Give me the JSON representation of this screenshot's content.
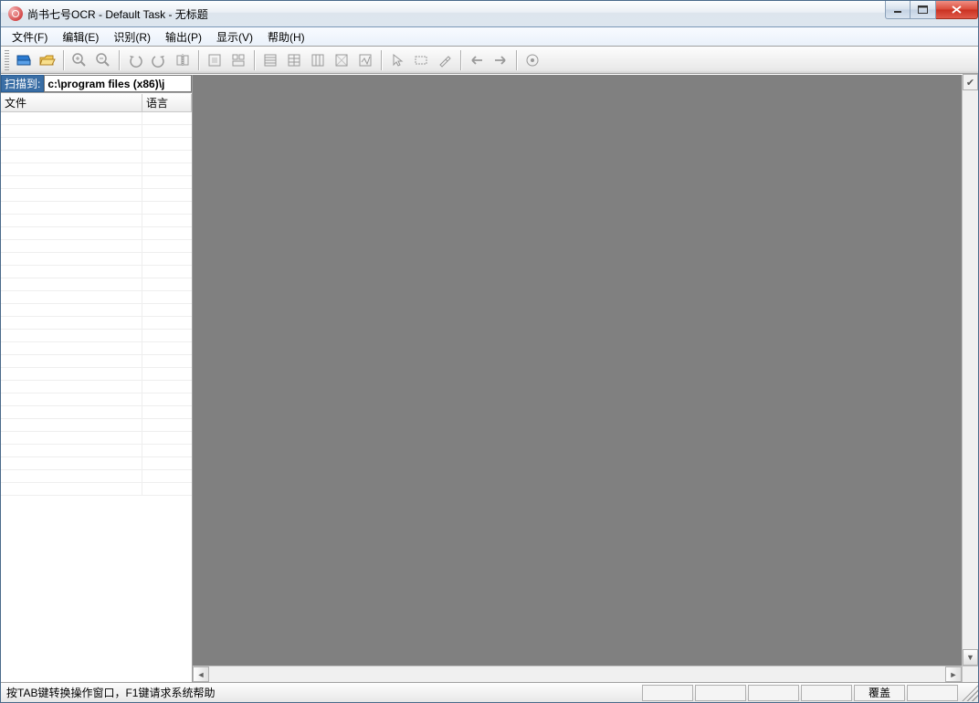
{
  "window": {
    "title": "尚书七号OCR - Default Task - 无标题"
  },
  "menu": {
    "file": "文件(F)",
    "edit": "编辑(E)",
    "recognize": "识别(R)",
    "output": "输出(P)",
    "view": "显示(V)",
    "help": "帮助(H)"
  },
  "sidebar": {
    "scan_label": "扫描到:",
    "path_value": "c:\\program files (x86)\\j",
    "col_file": "文件",
    "col_lang": "语言"
  },
  "status": {
    "text": "按TAB键转换操作窗口，F1键请求系统帮助",
    "overwrite": "覆盖"
  }
}
